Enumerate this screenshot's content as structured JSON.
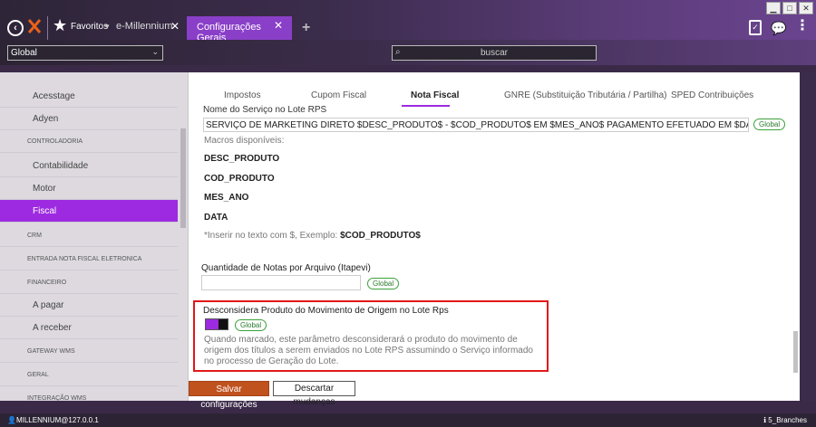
{
  "window": {
    "controls": [
      "▁",
      "□",
      "✕"
    ]
  },
  "header": {
    "favorites_label": "Favoritos",
    "favorites_caret": "▾",
    "tabs": [
      {
        "label": "e-Millennium",
        "active": false
      },
      {
        "label": "Configurações Gerais",
        "active": true
      }
    ],
    "add_tab": "+",
    "icons": [
      "back-icon",
      "logo-icon",
      "star-icon",
      "clipboard-icon",
      "chat-icon",
      "more-icon"
    ]
  },
  "toolbar": {
    "scope_value": "Global",
    "search_placeholder": "buscar"
  },
  "sidebar": {
    "items": [
      {
        "label": "Acesstage",
        "type": "item"
      },
      {
        "label": "Adyen",
        "type": "item"
      },
      {
        "label": "CONTROLADORIA",
        "type": "group"
      },
      {
        "label": "Contabilidade",
        "type": "item"
      },
      {
        "label": "Motor",
        "type": "item"
      },
      {
        "label": "Fiscal",
        "type": "item",
        "active": true
      },
      {
        "label": "CRM",
        "type": "group"
      },
      {
        "label": "ENTRADA NOTA FISCAL ELETRONICA",
        "type": "group"
      },
      {
        "label": "FINANCEIRO",
        "type": "group"
      },
      {
        "label": "A pagar",
        "type": "item"
      },
      {
        "label": "A receber",
        "type": "item"
      },
      {
        "label": "GATEWAY WMS",
        "type": "group"
      },
      {
        "label": "GERAL",
        "type": "group"
      },
      {
        "label": "INTEGRAÇÃO WMS",
        "type": "group"
      }
    ]
  },
  "main": {
    "tabs": [
      {
        "label": "Impostos"
      },
      {
        "label": "Cupom Fiscal"
      },
      {
        "label": "Nota Fiscal",
        "active": true
      },
      {
        "label": "GNRE (Substituição Tributária / Partilha)"
      },
      {
        "label": "SPED Contribuições"
      }
    ],
    "service_name_label": "Nome do Serviço no Lote RPS",
    "service_name_value": "SERVIÇO DE MARKETING DIRETO $DESC_PRODUTO$ - $COD_PRODUTO$ EM $MES_ANO$ PAGAMENTO EFETUADO EM $DATA$",
    "global_badge": "Global",
    "macros_title": "Macros disponíveis:",
    "macros": [
      "DESC_PRODUTO",
      "COD_PRODUTO",
      "MES_ANO",
      "DATA"
    ],
    "hint_prefix": "*Inserir no texto com $, Exemplo: ",
    "hint_example": "$COD_PRODUTO$",
    "qty_label": "Quantidade de Notas por Arquivo (Itapevi)",
    "qty_value": "",
    "disregard_label": "Desconsidera Produto do Movimento de Origem no Lote Rps",
    "disregard_checked": true,
    "disregard_help": "Quando marcado, este parâmetro desconsiderará o produto do movimento de origem dos títulos a serem enviados no Lote RPS assumindo o Serviço informado no processo de Geração do Lote."
  },
  "actions": {
    "save_label": "Salvar configurações",
    "discard_label": "Descartar mudanças"
  },
  "status": {
    "user": "MILLENNIUM@127.0.0.1",
    "branches": "5_Branches"
  },
  "colors": {
    "accent": "#9d2ae0",
    "save_button": "#c0521e",
    "highlight_border": "#e01818",
    "badge_green": "#3aa23a"
  }
}
